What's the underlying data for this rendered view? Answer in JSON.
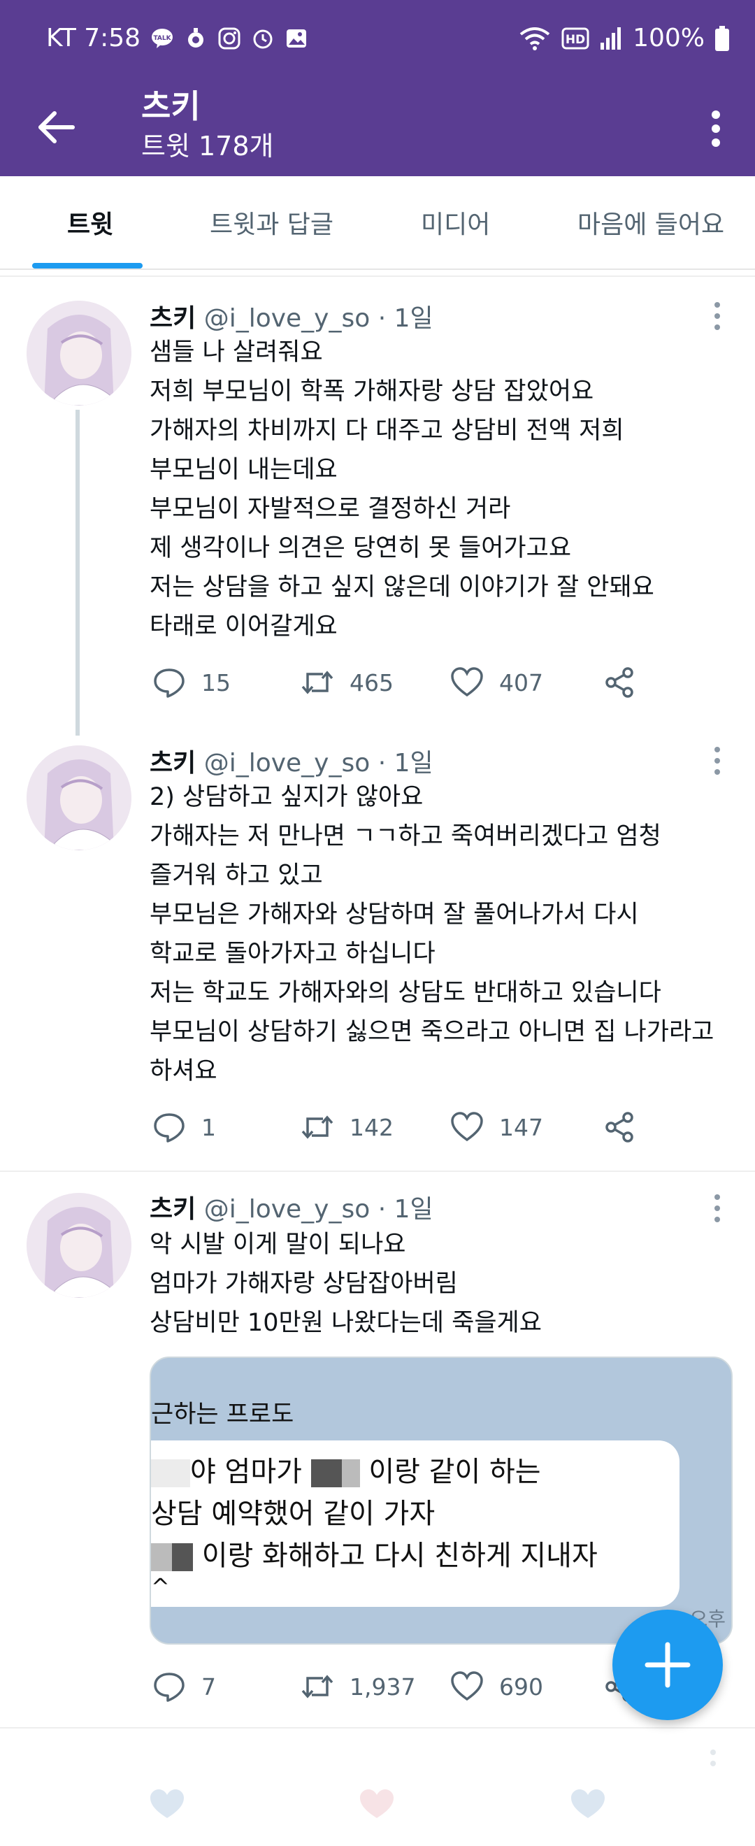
{
  "status_bar": {
    "carrier_time": "KT 7:58",
    "battery": "100%",
    "left_icons": [
      "kakaotalk-icon",
      "location-icon",
      "instagram-icon",
      "alarm-icon",
      "gallery-icon"
    ],
    "right_icons": [
      "wifi-icon",
      "hd-icon",
      "signal-icon",
      "battery-icon"
    ]
  },
  "app_bar": {
    "title": "츠키",
    "subtitle": "트윗 178개"
  },
  "tabs": [
    {
      "label": "트윗",
      "active": true
    },
    {
      "label": "트윗과 답글",
      "active": false
    },
    {
      "label": "미디어",
      "active": false
    },
    {
      "label": "마음에 들어요",
      "active": false
    }
  ],
  "tweets": [
    {
      "name": "츠키",
      "handle": "@i_love_y_so · 1일",
      "lines": [
        "샘들 나 살려줘요",
        "저희 부모님이 학폭 가해자랑 상담 잡았어요",
        "가해자의 차비까지 다 대주고 상담비 전액 저희",
        "부모님이 내는데요",
        "부모님이 자발적으로 결정하신 거라",
        "제 생각이나 의견은 당연히 못 들어가고요",
        "저는 상담을 하고 싶지 않은데 이야기가 잘 안돼요",
        "타래로 이어갈게요"
      ],
      "replies": "15",
      "retweets": "465",
      "likes": "407"
    },
    {
      "name": "츠키",
      "handle": "@i_love_y_so · 1일",
      "lines": [
        "2) 상담하고 싶지가 않아요",
        "가해자는 저 만나면 ㄱㄱ하고 죽여버리겠다고 엄청",
        "즐거워 하고 있고",
        "부모님은 가해자와 상담하며 잘 풀어나가서 다시",
        "학교로 돌아가자고 하십니다",
        "저는 학교도 가해자와의 상담도 반대하고 있습니다",
        "부모님이 상담하기 싫으면 죽으라고 아니면 집 나가라고",
        "하셔요"
      ],
      "replies": "1",
      "retweets": "142",
      "likes": "147"
    },
    {
      "name": "츠키",
      "handle": "@i_love_y_so · 1일",
      "lines": [
        "악 시발 이게 말이 되나요",
        "엄마가 가해자랑 상담잡아버림",
        "상담비만 10만원 나왔다는데 죽을게요"
      ],
      "embed": {
        "top_text": "근하는 프로도",
        "line1_a": "야 엄마가",
        "line1_b": "이랑 같이 하는",
        "line2": "상담 예약했어 같이 가자",
        "line3": "이랑 화해하고 다시 친하게 지내자",
        "line4": "^",
        "corner": "오후"
      },
      "replies": "7",
      "retweets": "1,937",
      "likes": "690"
    }
  ],
  "colors": {
    "brand": "#5a3d92",
    "accent": "#1d9bf0",
    "muted": "#536471"
  }
}
